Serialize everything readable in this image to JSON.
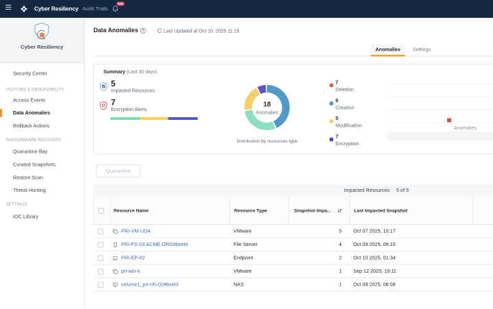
{
  "navbar": {
    "title": "Cyber Resiliency",
    "items": [
      {
        "label": "Audit Trails"
      }
    ],
    "notifications": {
      "badge": "846"
    }
  },
  "sidebar": {
    "title": "Cyber Resiliency",
    "accent_color": "#f0912e",
    "entries": [
      {
        "type": "item",
        "label": "Security Center",
        "active": false
      },
      {
        "type": "section",
        "label": "POSTURE & OBSERVABILITY"
      },
      {
        "type": "item",
        "label": "Access Events",
        "active": false
      },
      {
        "type": "item",
        "label": "Data Anomalies",
        "active": true
      },
      {
        "type": "item",
        "label": "Rollback Actions",
        "active": false
      },
      {
        "type": "section",
        "label": "RANSOMWARE RECOVERY"
      },
      {
        "type": "item",
        "label": "Quarantine Bay",
        "active": false
      },
      {
        "type": "item",
        "label": "Curated Snapshots",
        "active": false
      },
      {
        "type": "item",
        "label": "Restore Scan",
        "active": false
      },
      {
        "type": "item",
        "label": "Threat Hunting",
        "active": false
      },
      {
        "type": "section",
        "label": "SETTINGS"
      },
      {
        "type": "item",
        "label": "IOC Library",
        "active": false
      }
    ]
  },
  "page": {
    "title": "Data Anomalies",
    "last_updated": "Last Updated at Oct 10, 2025 11:19",
    "tabs": [
      {
        "label": "Anomalies",
        "active": true
      },
      {
        "label": "Settings",
        "active": false
      }
    ],
    "tab_accent_color": "#eea030"
  },
  "summary": {
    "title": "Summary",
    "subtitle": "(Last 30 days)",
    "metrics": [
      {
        "icon": "shield-check-icon",
        "value": "5",
        "label": "Impacted Resources"
      },
      {
        "icon": "shield-virus-icon",
        "value": "7",
        "label": "Encryption Alerts"
      }
    ],
    "donut": {
      "center_value": "18",
      "center_label": "Anomalies",
      "caption": "Distribution by resources type"
    },
    "legend": [
      {
        "value": "7",
        "label": "Deletion",
        "color": "#e0614f"
      },
      {
        "value": "8",
        "label": "Creation",
        "color": "#4a94c8"
      },
      {
        "value": "5",
        "label": "Modification",
        "color": "#f0d063"
      },
      {
        "value": "7",
        "label": "Encryption",
        "color": "#474bc4"
      }
    ],
    "trend_legend": {
      "label": "Anomalies",
      "color": "#d9534f"
    }
  },
  "chart_data": [
    {
      "type": "pie",
      "variant": "donut",
      "title": "Distribution by resources type",
      "center_total": 18,
      "center_label": "Anomalies",
      "segments": [
        {
          "color": "#4e9aca",
          "fraction": 0.44
        },
        {
          "color": "#8edec2",
          "fraction": 0.295
        },
        {
          "color": "#f5d069",
          "fraction": 0.195
        },
        {
          "color": "#5a55cd",
          "fraction": 0.07
        }
      ]
    },
    {
      "type": "bar",
      "variant": "stacked-progress-bar",
      "segments": [
        {
          "color": "#7ddcb3",
          "fraction": 0.34
        },
        {
          "color": "#f7d164",
          "fraction": 0.32
        },
        {
          "color": "#5659c9",
          "fraction": 0.34
        }
      ]
    },
    {
      "type": "line",
      "series": [
        {
          "name": "Anomalies",
          "color": "#d9534f"
        }
      ],
      "note": "plot cut off at right viewport edge; only gridlines, legend swatch and zoom slider visible"
    }
  ],
  "table": {
    "action_button": {
      "label": "Quarantine",
      "disabled": true
    },
    "toolbar": {
      "label": "Impacted Resources",
      "count": "5 of 5"
    },
    "columns": [
      {
        "label": "Resource Name"
      },
      {
        "label": "Resource Type"
      },
      {
        "label": "Snapshot Impa...",
        "sortable": true,
        "sort_icon": "arrows-vertical-icon"
      },
      {
        "label": "Last Impacted Snapshot"
      }
    ],
    "rows": [
      {
        "icon": "vm-icon",
        "name": "PRI-VM-UDA",
        "type": "VMware",
        "snapshots": "5",
        "last_snapshot": "Oct 07 2025, 10:17"
      },
      {
        "icon": "file-server-icon",
        "name": "PRI-FS-03.ACME.ORG#bset4",
        "type": "File Server",
        "snapshots": "4",
        "last_snapshot": "Oct 09 2025, 06:10"
      },
      {
        "icon": "endpoint-icon",
        "name": "PRI-EP-02",
        "type": "Endpoint",
        "snapshots": "2",
        "last_snapshot": "Oct 10 2025, 01:34"
      },
      {
        "icon": "vm-icon",
        "name": "pri-win-ir",
        "type": "VMware",
        "snapshots": "1",
        "last_snapshot": "Sep 12 2025, 19:11"
      },
      {
        "icon": "nas-icon",
        "name": "volume1_pri-nfs-02#bset3",
        "type": "NAS",
        "snapshots": "1",
        "last_snapshot": "Oct 08 2025, 06:08"
      }
    ]
  }
}
